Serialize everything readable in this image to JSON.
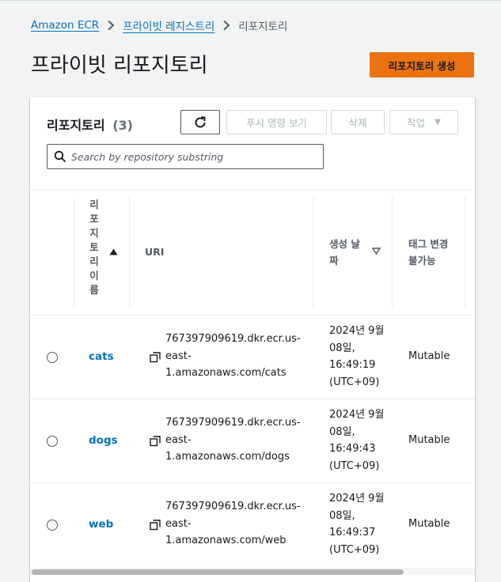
{
  "breadcrumb": {
    "items": [
      {
        "label": "Amazon ECR"
      },
      {
        "label": "프라이빗 레지스트리"
      },
      {
        "label": "리포지토리"
      }
    ]
  },
  "page": {
    "title": "프라이빗 리포지토리",
    "create_button": "리포지토리 생성"
  },
  "panel": {
    "title": "리포지토리",
    "count": "(3)",
    "buttons": {
      "push_commands": "푸시 명령 보기",
      "delete": "삭제",
      "actions": "작업"
    },
    "search": {
      "placeholder": "Search by repository substring",
      "value": ""
    }
  },
  "table": {
    "columns": {
      "name": "리포지토리이름",
      "uri": "URI",
      "created": "생성 날짜",
      "immutability": "태그 변경 불가능"
    },
    "rows": [
      {
        "name": "cats",
        "uri": "767397909619.dkr.ecr.us-east-1.amazonaws.com/cats",
        "created": "2024년 9월 08일, 16:49:19 (UTC+09)",
        "immutability": "Mutable"
      },
      {
        "name": "dogs",
        "uri": "767397909619.dkr.ecr.us-east-1.amazonaws.com/dogs",
        "created": "2024년 9월 08일, 16:49:43 (UTC+09)",
        "immutability": "Mutable"
      },
      {
        "name": "web",
        "uri": "767397909619.dkr.ecr.us-east-1.amazonaws.com/web",
        "created": "2024년 9월 08일, 16:49:37 (UTC+09)",
        "immutability": "Mutable"
      }
    ]
  },
  "colors": {
    "accent_orange": "#ec7211",
    "link_blue": "#0073bb",
    "background": "#f2f3f3"
  }
}
